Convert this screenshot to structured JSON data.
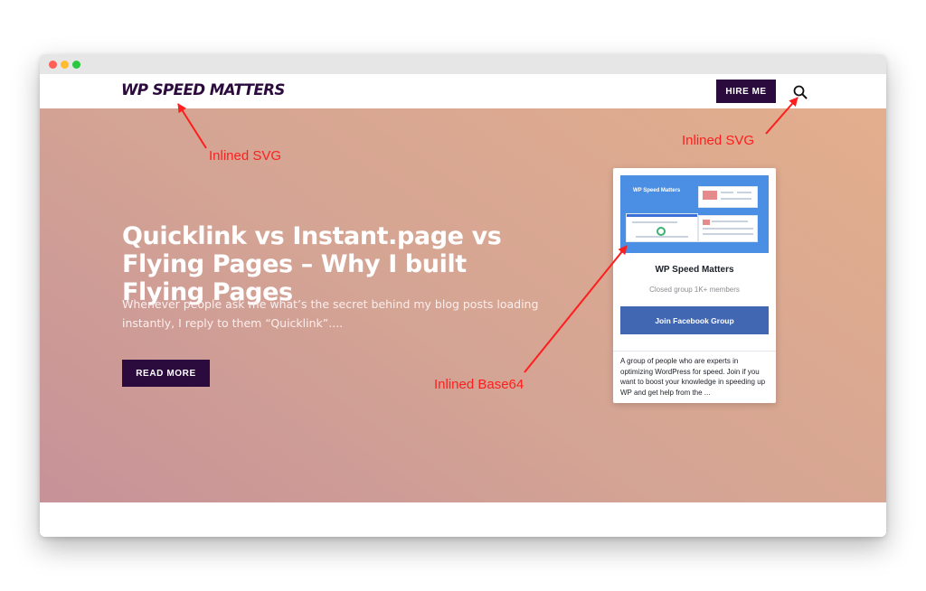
{
  "header": {
    "logo_text": "WP SPEED MATTERS",
    "hire_button": "HIRE ME",
    "search_icon": "search-icon"
  },
  "hero": {
    "title": "Quicklink vs Instant.page vs Flying Pages – Why I built Flying Pages",
    "excerpt": "Whenever people ask me what’s the secret behind my blog posts loading instantly, I reply to them “Quicklink”....",
    "read_more": "READ MORE"
  },
  "fb_widget": {
    "thumbnail_title": "WP Speed Matters",
    "group_name": "WP Speed Matters",
    "meta": "Closed group 1K+ members",
    "join_button": "Join Facebook Group",
    "description": "A group of people who are experts in optimizing WordPress for speed. Join if you want to boost your knowledge in speeding up WP and get help from the ..."
  },
  "annotations": {
    "logo_note": "Inlined SVG",
    "search_note": "Inlined SVG",
    "image_note": "Inlined Base64"
  },
  "colors": {
    "brand_dark": "#2b0a3d",
    "facebook_blue": "#4267b2",
    "annotation_red": "#ff1e1e"
  }
}
